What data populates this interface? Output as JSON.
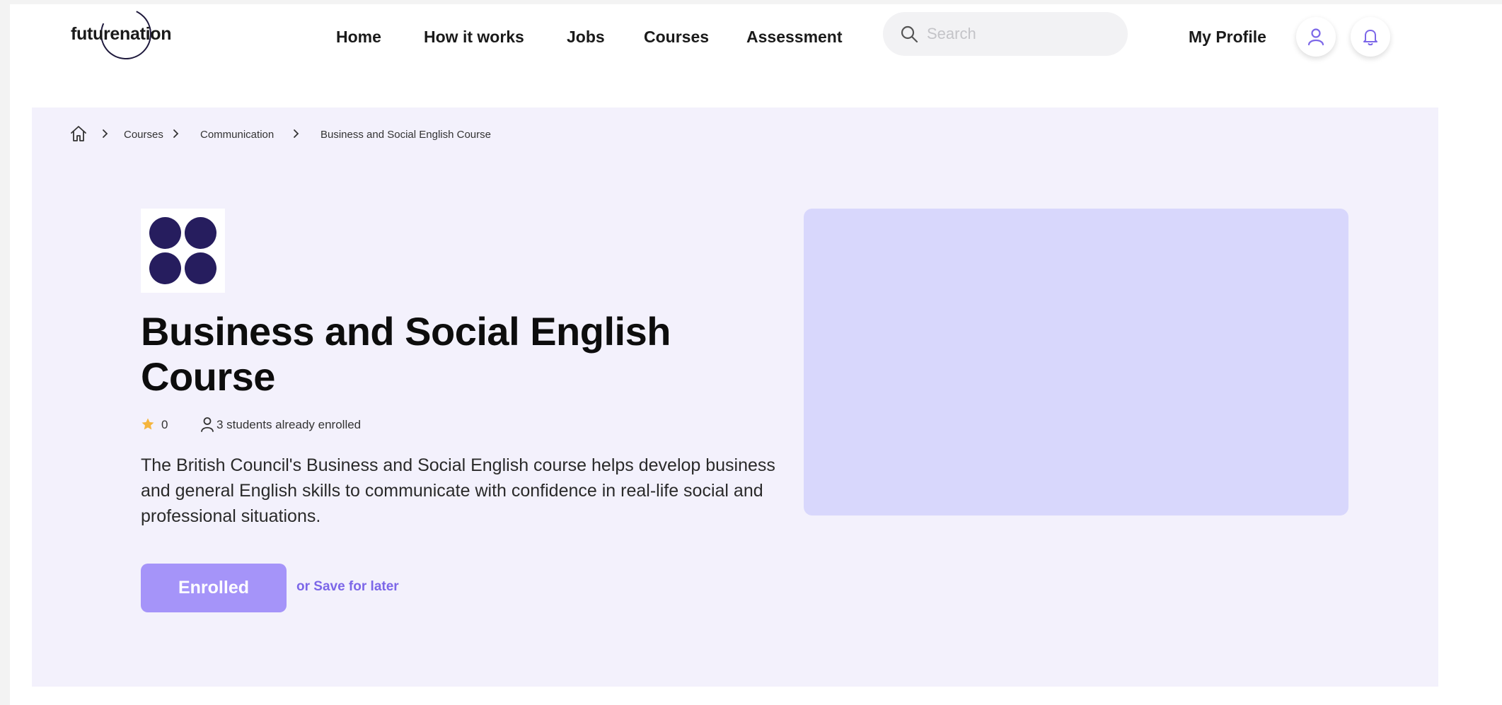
{
  "header": {
    "logo_text": "futurenation",
    "nav": [
      "Home",
      "How it works",
      "Jobs",
      "Courses",
      "Assessment"
    ],
    "search_placeholder": "Search",
    "profile_label": "My Profile"
  },
  "breadcrumb": {
    "items": [
      "Courses",
      "Communication",
      "Business and Social English Course"
    ]
  },
  "course": {
    "title": "Business and Social English Course",
    "rating": "0",
    "enrolled_text": "3 students already enrolled",
    "description": "The British Council's Business and Social English course helps develop business and general English skills to communicate with confidence in real-life social and professional situations.",
    "primary_button": "Enrolled",
    "secondary_link": "or Save for later"
  },
  "icons": {
    "search": "search-icon",
    "user": "user-icon",
    "bell": "bell-icon",
    "home": "home-icon",
    "star": "star-icon",
    "chevron": "chevron-right-icon"
  },
  "colors": {
    "hero_background": "#f3f1fc",
    "media_placeholder": "#d8d7fc",
    "primary_button": "#a594f9",
    "accent": "#7c67e8",
    "course_logo": "#261d5e",
    "star": "#f5b53d"
  }
}
